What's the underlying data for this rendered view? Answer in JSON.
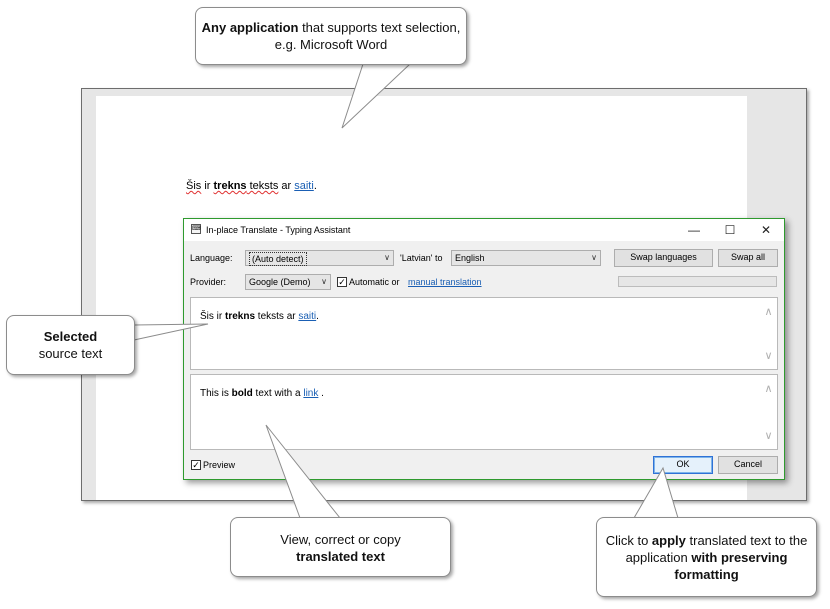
{
  "callouts": {
    "top": {
      "bold": "Any application",
      "rest": " that supports text selection, e.g. Microsoft Word"
    },
    "left": {
      "bold": "Selected",
      "rest": "source text"
    },
    "bottom_mid": {
      "line1": "View, correct or copy",
      "bold": "translated text"
    },
    "bottom_right": {
      "pre": "Click to ",
      "bold1": "apply",
      "mid": " translated text to the application ",
      "bold2": "with preserving formatting"
    }
  },
  "document": {
    "w1": "Šis",
    "w2": " ir ",
    "w3": "trekns",
    "w4": " teksts",
    "w5": " ar ",
    "link": "saiti",
    "end": "."
  },
  "dialog": {
    "title": "In-place Translate - Typing Assistant",
    "language_label": "Language:",
    "source_language": "(Auto detect)",
    "detected_to": "'Latvian' to",
    "target_language": "English",
    "swap_languages": "Swap languages",
    "swap_all": "Swap all",
    "provider_label": "Provider:",
    "provider": "Google (Demo)",
    "automatic_label": "Automatic or",
    "manual_link": "manual translation",
    "source_text": {
      "t1": "Šis ir ",
      "bold": "trekns",
      "t2": " teksts ar ",
      "link": "saiti",
      "t3": "."
    },
    "translated_text": {
      "t1": "This is ",
      "bold": "bold",
      "t2": " text with a ",
      "link": "link",
      "t3": " ."
    },
    "preview_label": "Preview",
    "ok": "OK",
    "cancel": "Cancel",
    "automatic_checked": true,
    "preview_checked": true
  },
  "icons": {
    "minimize": "minimize-icon",
    "maximize": "maximize-icon",
    "close": "close-icon",
    "dropdown": "chevron-down-icon",
    "scroll_up": "scroll-up-icon",
    "scroll_down": "scroll-down-icon"
  },
  "colors": {
    "accent_link": "#1a5fb4",
    "dialog_border": "#2e9a2e",
    "ok_border": "#2f72d6"
  }
}
